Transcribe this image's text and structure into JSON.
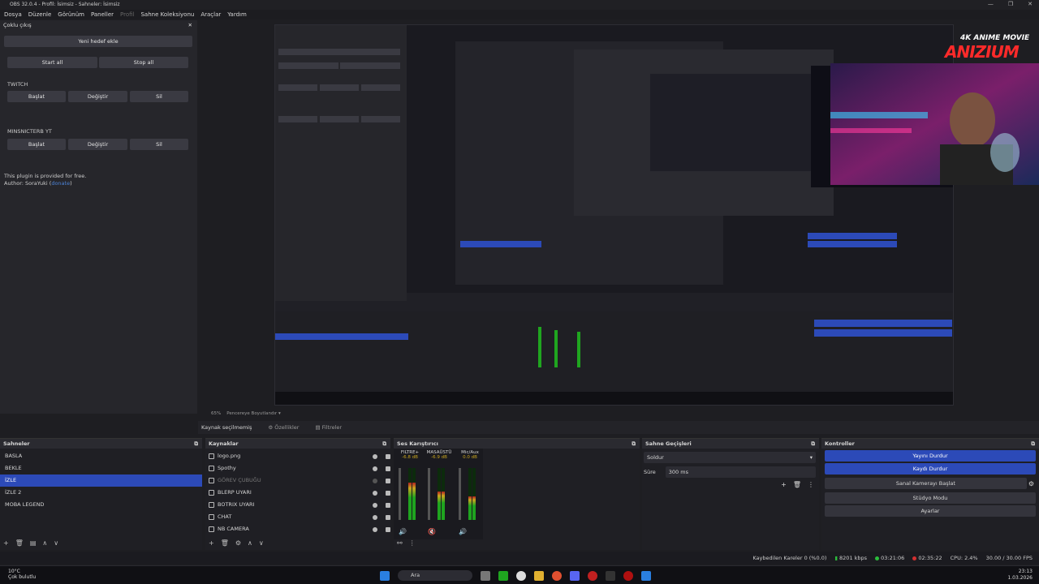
{
  "window": {
    "title": "OBS 32.0.4 - Profil: İsimsiz - Sahneler: İsimsiz"
  },
  "menu": [
    "Dosya",
    "Düzenle",
    "Görünüm",
    "Paneller",
    "Profil",
    "Sahne Koleksiyonu",
    "Araçlar",
    "Yardım"
  ],
  "multi": {
    "title": "Çoklu çıkış",
    "add_target": "Yeni hedef ekle",
    "start_all": "Start all",
    "stop_all": "Stop all",
    "targets": [
      {
        "name": "TWITCH",
        "start": "Başlat",
        "edit": "Değiştir",
        "del": "Sil"
      },
      {
        "name": "MINSNICTERB YT",
        "start": "Başlat",
        "edit": "Değiştir",
        "del": "Sil"
      }
    ],
    "note1": "This plugin is provided for free.",
    "note2": "Author: SoraYuki (",
    "note_link": "donate",
    "note3": ")"
  },
  "overlay": {
    "brand_top": "4K ANIME MOVIE",
    "brand": "ANIZIUM"
  },
  "preview_bar": {
    "zoom": "65%",
    "fit": "Pencereye Boyutlandır"
  },
  "srcbar": {
    "selected": "Kaynak seçilmemiş",
    "props": "Özellikler",
    "filters": "Filtreler"
  },
  "scenes": {
    "title": "Sahneler",
    "items": [
      "BASLA",
      "BEKLE",
      "İZLE",
      "İZLE 2",
      "MOBA LEGEND"
    ],
    "selected_index": 2
  },
  "sources": {
    "title": "Kaynaklar",
    "items": [
      "logo.png",
      "Spothy",
      "GÖREV ÇUBUĞU",
      "BLERP UYARI",
      "BOTRIX UYARI",
      "CHAT",
      "NB CAMERA"
    ]
  },
  "mixer": {
    "title": "Ses Karıştırıcı",
    "channels": [
      {
        "name": "FILTRE+",
        "db": "-6.8 dB",
        "level": 0.72
      },
      {
        "name": "MASAÜSTÜ",
        "db": "-6.9 dB",
        "level": 0.55
      },
      {
        "name": "Mic/Aux",
        "db": "0.0 dB",
        "level": 0.45
      }
    ],
    "scale": [
      "0",
      "-5",
      "-10",
      "-15",
      "-20",
      "-25",
      "-30",
      "-35",
      "-40",
      "-45",
      "-50",
      "-55",
      "-60"
    ]
  },
  "transitions": {
    "title": "Sahne Geçişleri",
    "type": "Soldur",
    "duration_label": "Süre",
    "duration": "300 ms"
  },
  "controls": {
    "title": "Kontroller",
    "stop_stream": "Yayını Durdur",
    "stop_record": "Kaydı Durdur",
    "virtual_cam": "Sanal Kamerayı Başlat",
    "studio": "Stüdyo Modu",
    "settings": "Ayarlar"
  },
  "status": {
    "dropped": "Kaybedilen Kareler 0 (%0.0)",
    "bitrate": "8201 kbps",
    "stream_time": "03:21:06",
    "rec_time": "02:35:22",
    "cpu": "CPU: 2.4%",
    "fps": "30.00 / 30.00 FPS"
  },
  "taskbar": {
    "temp": "10°C",
    "weather": "Çok bulutlu",
    "search": "Ara",
    "time": "23:13",
    "date": "1.03.2026"
  },
  "colors": {
    "accent": "#2c4ab8",
    "panel": "#1f1f24",
    "meter_green": "#1fa51f"
  }
}
